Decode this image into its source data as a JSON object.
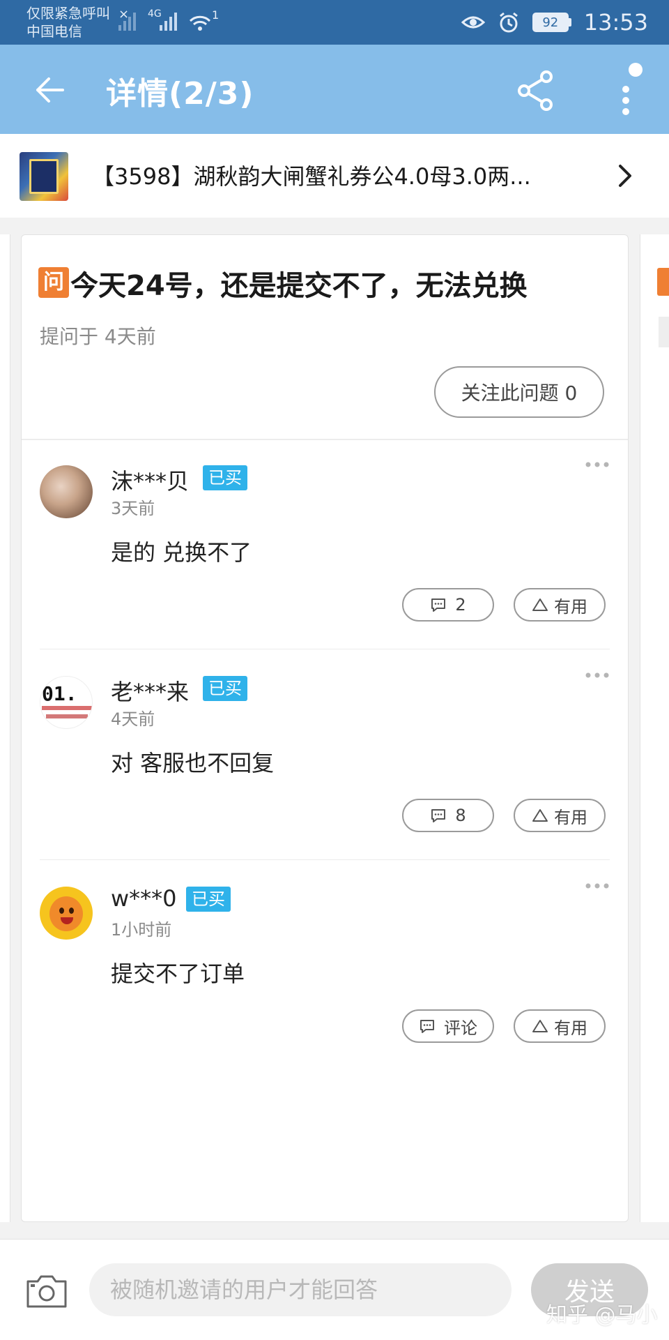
{
  "status_bar": {
    "carrier_line1": "仅限紧急呼叫",
    "carrier_line2": "中国电信",
    "network_label": "4G",
    "wifi_superscript": "1",
    "battery_level": "92",
    "time": "13:53"
  },
  "app_bar": {
    "title": "详情(2/3)"
  },
  "product": {
    "title": "【3598】湖秋韵大闸蟹礼券公4.0母3.0两..."
  },
  "question": {
    "badge": "问",
    "title": "今天24号，还是提交不了，无法兑换",
    "meta": "提问于 4天前",
    "follow_label": "关注此问题 0"
  },
  "answers": [
    {
      "user": "沫***贝",
      "badge": "已买",
      "time": "3天前",
      "text": "是的 兑换不了",
      "comment_label": "2",
      "useful_label": "有用"
    },
    {
      "user": "老***来",
      "badge": "已买",
      "time": "4天前",
      "text": "对 客服也不回复",
      "comment_label": "8",
      "useful_label": "有用",
      "avatar_text": "01."
    },
    {
      "user": "w***0",
      "badge": "已买",
      "time": "1小时前",
      "text": "提交不了订单",
      "comment_label": "评论",
      "useful_label": "有用"
    }
  ],
  "bottom_bar": {
    "input_placeholder": "被随机邀请的用户才能回答",
    "send_label": "发送"
  },
  "watermark": "知乎 @马小"
}
